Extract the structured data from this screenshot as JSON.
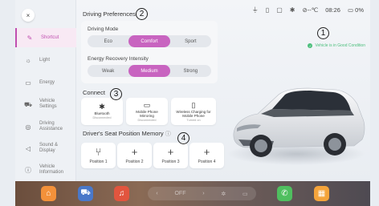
{
  "status_bar": {
    "icons": [
      "usb-icon",
      "sim-icon",
      "screen-cast-icon",
      "bluetooth-icon"
    ],
    "temperature": "--℃",
    "time": "08:26",
    "battery": "0%"
  },
  "sidebar": {
    "close_icon": "×",
    "items": [
      {
        "label": "Shortcut",
        "icon": "pen-icon",
        "glyph": "✎",
        "active": true
      },
      {
        "label": "Light",
        "icon": "sun-icon",
        "glyph": "☼",
        "active": false
      },
      {
        "label": "Energy",
        "icon": "battery-icon",
        "glyph": "▭",
        "active": false
      },
      {
        "label": "Vehicle Settings",
        "icon": "car-icon",
        "glyph": "⛟",
        "active": false
      },
      {
        "label": "Driving Assistance",
        "icon": "steering-wheel-icon",
        "glyph": "◎",
        "active": false
      },
      {
        "label": "Sound & Display",
        "icon": "speaker-icon",
        "glyph": "◁",
        "active": false
      },
      {
        "label": "Vehicle Information",
        "icon": "info-icon",
        "glyph": "ⓘ",
        "active": false
      }
    ]
  },
  "driving_preferences": {
    "title": "Driving Preferences",
    "mode_label": "Driving Mode",
    "modes": [
      "Eco",
      "Comfort",
      "Sport"
    ],
    "selected_mode": "Comfort",
    "energy_label": "Energy Recovery Intensity",
    "energy_options": [
      "Weak",
      "Medium",
      "Strong"
    ],
    "selected_energy": "Medium"
  },
  "connect": {
    "title": "Connect",
    "items": [
      {
        "title": "Bluetooth",
        "status": "Disconnected",
        "icon": "bluetooth-icon",
        "glyph": "✱"
      },
      {
        "title": "Mobile Phone Mirroring",
        "status": "Disconnected",
        "icon": "screen-mirror-icon",
        "glyph": "▭"
      },
      {
        "title": "Wireless Charging for Mobile Phone",
        "status": "Turned on",
        "icon": "phone-charging-icon",
        "glyph": "▯"
      }
    ]
  },
  "seat_memory": {
    "title": "Driver's Seat Position Memory",
    "info_icon": "ⓘ",
    "positions": [
      {
        "label": "Position 1",
        "icon": "seat-icon",
        "glyph": "⑂"
      },
      {
        "label": "Position 2",
        "icon": "plus-icon",
        "glyph": "+"
      },
      {
        "label": "Position 3",
        "icon": "plus-icon",
        "glyph": "+"
      },
      {
        "label": "Position 4",
        "icon": "plus-icon",
        "glyph": "+"
      }
    ]
  },
  "vehicle_status": {
    "text": "Vehicle is in Good Condition",
    "color": "#4cbf7c"
  },
  "markers": [
    "1",
    "2",
    "3",
    "4"
  ],
  "dock": {
    "climate_off": "OFF",
    "apps": [
      {
        "name": "home-icon",
        "color": "#f3913a"
      },
      {
        "name": "car-icon",
        "color": "#4a78c9"
      },
      {
        "name": "music-icon",
        "color": "#e2553e"
      },
      {
        "name": "phone-icon",
        "color": "#4fbf5f"
      },
      {
        "name": "apps-grid-icon",
        "color": "#f4a43b"
      }
    ]
  },
  "colors": {
    "accent": "#c864c0"
  }
}
